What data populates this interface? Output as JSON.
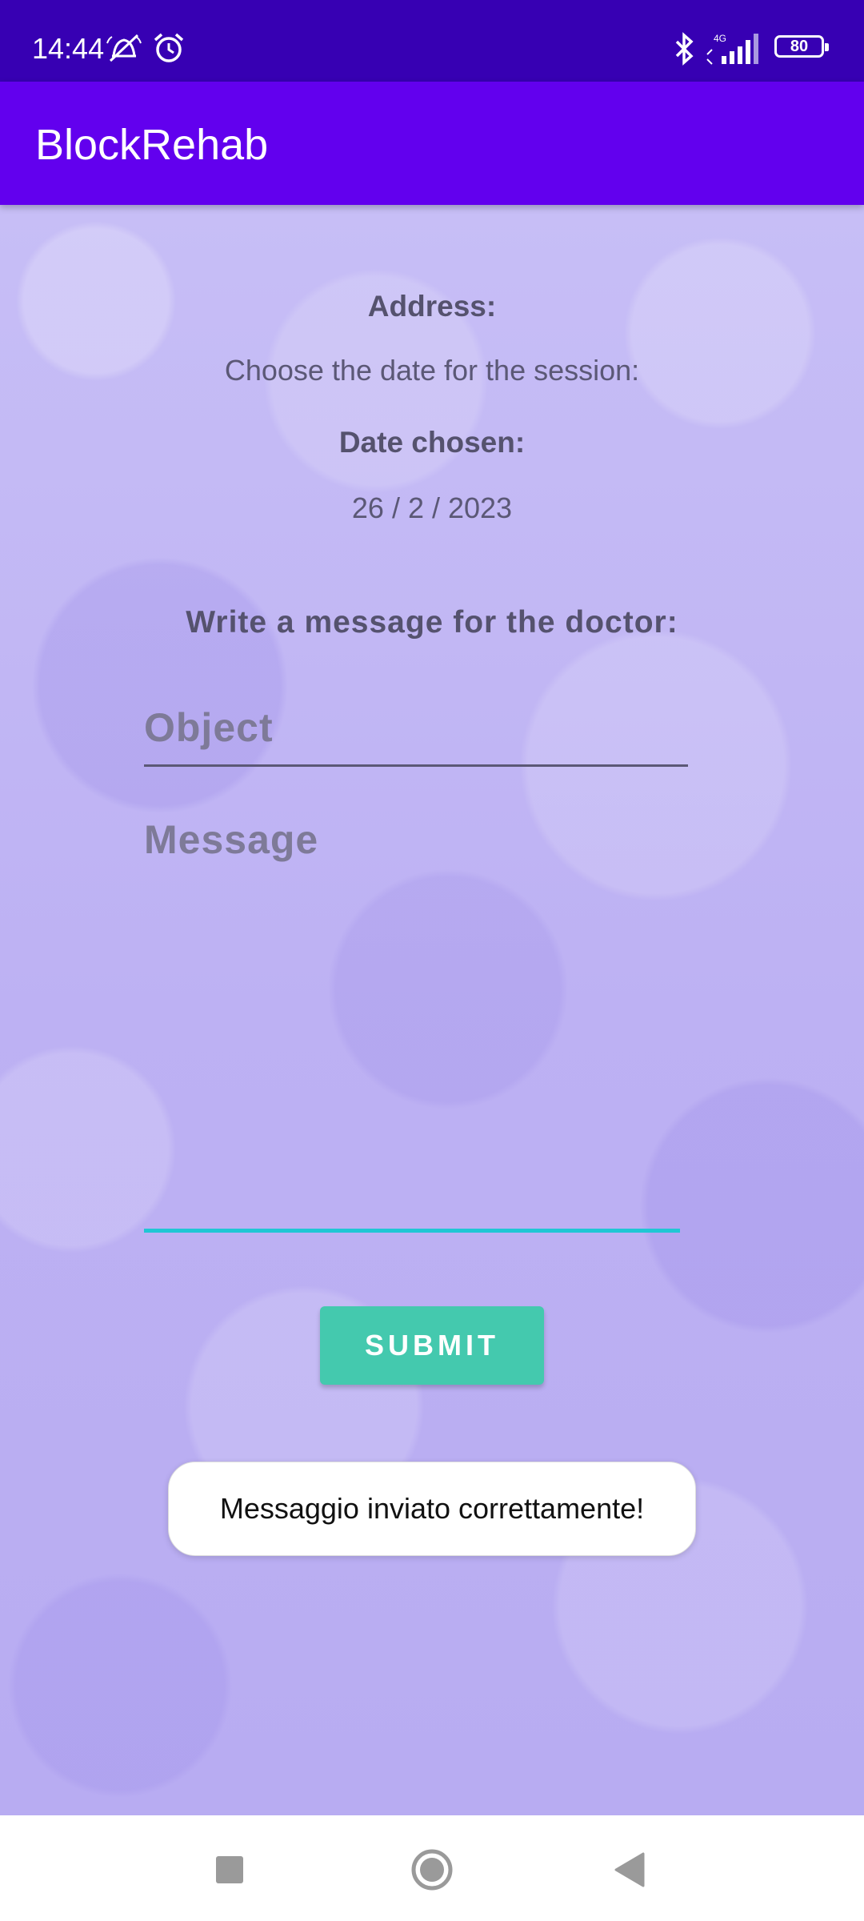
{
  "status_bar": {
    "time": "14:44",
    "battery": "80",
    "network": "4G",
    "icons": [
      "silent-alarm-icon",
      "alarm-clock-icon",
      "bluetooth-icon",
      "signal-icon",
      "battery-icon"
    ]
  },
  "app_bar": {
    "title": "BlockRehab"
  },
  "form": {
    "address_label": "Address:",
    "choose_date_text": "Choose the date for the session:",
    "date_chosen_label": "Date chosen:",
    "date_value": "26 / 2 / 2023",
    "message_heading": "Write a message for the doctor:",
    "object_placeholder": "Object",
    "message_placeholder": "Message",
    "submit_label": "SUBMIT"
  },
  "toast": {
    "text": "Messaggio inviato correttamente!"
  },
  "nav_bar": {
    "buttons": [
      "recents-icon",
      "home-icon",
      "back-icon"
    ]
  },
  "colors": {
    "status_bar": "#3700b3",
    "app_bar": "#6200ee",
    "submit_button": "#44c9ae",
    "message_underline": "#1fc7d4",
    "background": "#c4baf6"
  }
}
